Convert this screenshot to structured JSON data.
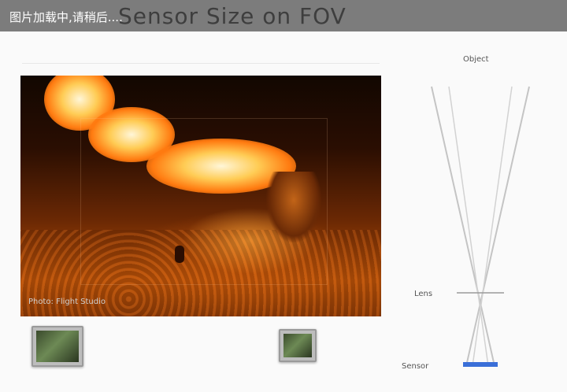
{
  "header": {
    "title": "Sensor Size on FOV",
    "loading_text": "图片加载中,请稍后...."
  },
  "photo": {
    "credit": "Photo: Flight Studio"
  },
  "diagram": {
    "object_label": "Object",
    "lens_label": "Lens",
    "sensor_label": "Sensor"
  },
  "colors": {
    "header_bg": "#7c7c7c",
    "sensor_blue": "#3a6fd8",
    "flame_orange": "#ff7a10"
  }
}
